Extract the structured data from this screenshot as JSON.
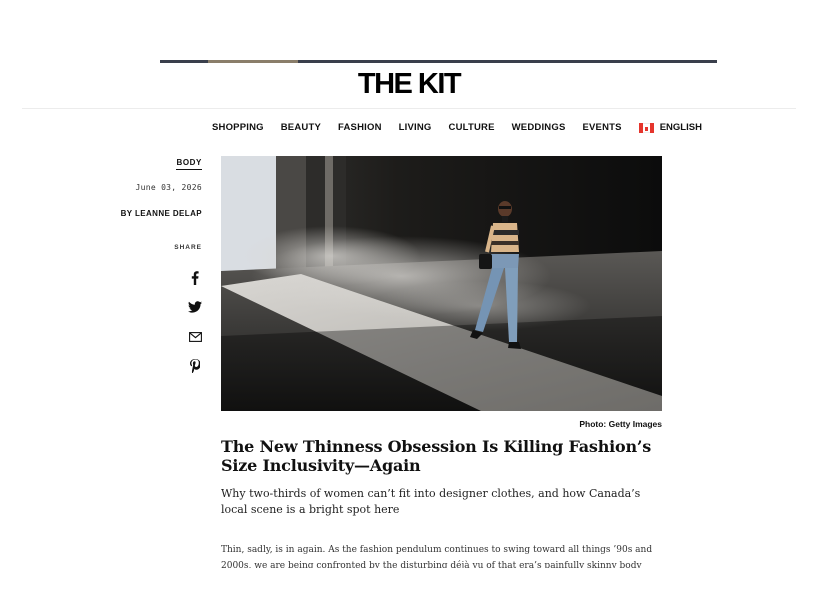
{
  "brand": {
    "logo": "THE KIT"
  },
  "nav": {
    "items": [
      "SHOPPING",
      "BEAUTY",
      "FASHION",
      "LIVING",
      "CULTURE",
      "WEDDINGS",
      "EVENTS"
    ],
    "language": "ENGLISH",
    "language_icon": "canada-flag-icon"
  },
  "article": {
    "category": "BODY",
    "date": "June 03, 2026",
    "byline": "BY LEANNE DELAP",
    "share_label": "SHARE",
    "share_icons": [
      "facebook-icon",
      "twitter-icon",
      "email-icon",
      "pinterest-icon"
    ],
    "photo_credit": "Photo: Getty Images",
    "headline": "The New Thinness Obsession Is Killing Fashion’s Size Inclusivity—Again",
    "dek": "Why two-thirds of women can’t fit into designer clothes, and how Canada’s local scene is a bright spot here",
    "body": "Thin, sadly, is in again. As the fashion pendulum continues to swing toward all things ’90s and 2000s, we are being confronted by the disturbing déjà vu of that era’s painfully skinny body ideals."
  },
  "colors": {
    "text": "#111111",
    "flag_red": "#e5352d",
    "hero_bg": "#141414"
  }
}
